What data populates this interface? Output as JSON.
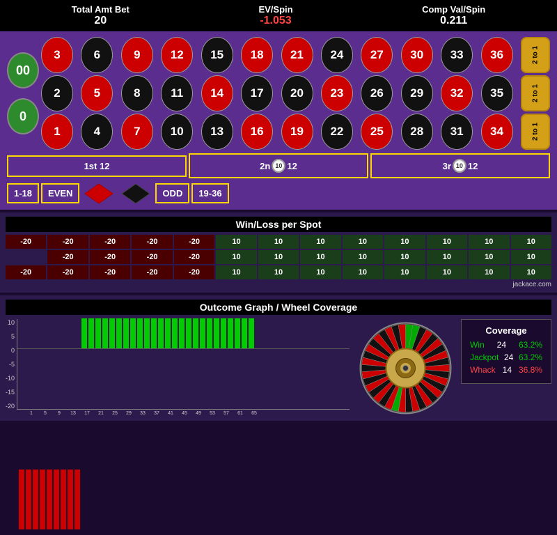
{
  "stats": {
    "total_amt_bet_label": "Total Amt Bet",
    "total_amt_bet_value": "20",
    "ev_spin_label": "EV/Spin",
    "ev_spin_value": "-1.053",
    "comp_val_label": "Comp Val/Spin",
    "comp_val_value": "0.211"
  },
  "roulette": {
    "zeros": [
      "00",
      "0"
    ],
    "numbers": [
      {
        "n": "3",
        "c": "red"
      },
      {
        "n": "6",
        "c": "black"
      },
      {
        "n": "9",
        "c": "red"
      },
      {
        "n": "12",
        "c": "red"
      },
      {
        "n": "15",
        "c": "black"
      },
      {
        "n": "18",
        "c": "red"
      },
      {
        "n": "21",
        "c": "red"
      },
      {
        "n": "24",
        "c": "black"
      },
      {
        "n": "27",
        "c": "red"
      },
      {
        "n": "30",
        "c": "red"
      },
      {
        "n": "33",
        "c": "black"
      },
      {
        "n": "36",
        "c": "red"
      },
      {
        "n": "2",
        "c": "black"
      },
      {
        "n": "5",
        "c": "red"
      },
      {
        "n": "8",
        "c": "black"
      },
      {
        "n": "11",
        "c": "black"
      },
      {
        "n": "14",
        "c": "red"
      },
      {
        "n": "17",
        "c": "black"
      },
      {
        "n": "20",
        "c": "black"
      },
      {
        "n": "23",
        "c": "red"
      },
      {
        "n": "26",
        "c": "black"
      },
      {
        "n": "29",
        "c": "black"
      },
      {
        "n": "32",
        "c": "red"
      },
      {
        "n": "35",
        "c": "black"
      },
      {
        "n": "1",
        "c": "red"
      },
      {
        "n": "4",
        "c": "black"
      },
      {
        "n": "7",
        "c": "red"
      },
      {
        "n": "10",
        "c": "black"
      },
      {
        "n": "13",
        "c": "black"
      },
      {
        "n": "16",
        "c": "red"
      },
      {
        "n": "19",
        "c": "red"
      },
      {
        "n": "22",
        "c": "black"
      },
      {
        "n": "25",
        "c": "red"
      },
      {
        "n": "28",
        "c": "black"
      },
      {
        "n": "31",
        "c": "black"
      },
      {
        "n": "34",
        "c": "red"
      }
    ],
    "tto": [
      "2 to 1",
      "2 to 1",
      "2 to 1"
    ],
    "dozens": [
      {
        "label": "1st 12",
        "chip": null
      },
      {
        "label": "2nd 12",
        "chip": "10"
      },
      {
        "label": "3rd 12",
        "chip": "10"
      }
    ],
    "evens": [
      "1-18",
      "EVEN",
      "",
      "",
      "ODD",
      "19-36"
    ]
  },
  "winloss": {
    "title": "Win/Loss per Spot",
    "rows": [
      [
        "-20",
        "-20",
        "-20",
        "-20",
        "-20",
        "10",
        "10",
        "10",
        "10",
        "10",
        "10",
        "10",
        "10"
      ],
      [
        "",
        "-20",
        "-20",
        "-20",
        "-20",
        "10",
        "10",
        "10",
        "10",
        "10",
        "10",
        "10",
        "10"
      ],
      [
        "-20",
        "-20",
        "-20",
        "-20",
        "-20",
        "10",
        "10",
        "10",
        "10",
        "10",
        "10",
        "10",
        "10"
      ]
    ],
    "highlight_row": 1,
    "highlight_col": 0
  },
  "outcome": {
    "title": "Outcome Graph / Wheel Coverage",
    "y_labels": [
      "10",
      "5",
      "0",
      "-5",
      "-10",
      "-15",
      "-20"
    ],
    "bars": [
      {
        "x": "1",
        "v": -20
      },
      {
        "x": "3",
        "v": -20
      },
      {
        "x": "5",
        "v": -20
      },
      {
        "x": "7",
        "v": -20
      },
      {
        "x": "9",
        "v": -20
      },
      {
        "x": "11",
        "v": -20
      },
      {
        "x": "13",
        "v": -20
      },
      {
        "x": "15",
        "v": -20
      },
      {
        "x": "17",
        "v": -20
      },
      {
        "x": "19",
        "v": 10
      },
      {
        "x": "21",
        "v": 10
      },
      {
        "x": "23",
        "v": 10
      },
      {
        "x": "25",
        "v": 10
      },
      {
        "x": "27",
        "v": 10
      },
      {
        "x": "29",
        "v": 10
      },
      {
        "x": "31",
        "v": 10
      },
      {
        "x": "33",
        "v": 10
      },
      {
        "x": "35",
        "v": 10
      },
      {
        "x": "37",
        "v": 10
      },
      {
        "x": "39",
        "v": 10
      },
      {
        "x": "41",
        "v": 10
      },
      {
        "x": "43",
        "v": 10
      },
      {
        "x": "45",
        "v": 10
      },
      {
        "x": "47",
        "v": 10
      },
      {
        "x": "49",
        "v": 10
      },
      {
        "x": "51",
        "v": 10
      },
      {
        "x": "53",
        "v": 10
      },
      {
        "x": "55",
        "v": 10
      },
      {
        "x": "57",
        "v": 10
      },
      {
        "x": "59",
        "v": 10
      },
      {
        "x": "61",
        "v": 10
      },
      {
        "x": "63",
        "v": 10
      },
      {
        "x": "65",
        "v": 10
      },
      {
        "x": "67",
        "v": 10
      }
    ],
    "coverage": {
      "title": "Coverage",
      "win_label": "Win",
      "win_count": "24",
      "win_pct": "63.2%",
      "jackpot_label": "Jackpot",
      "jackpot_count": "24",
      "jackpot_pct": "63.2%",
      "whack_label": "Whack",
      "whack_count": "14",
      "whack_pct": "36.8%"
    }
  },
  "credit": "jackace.com"
}
